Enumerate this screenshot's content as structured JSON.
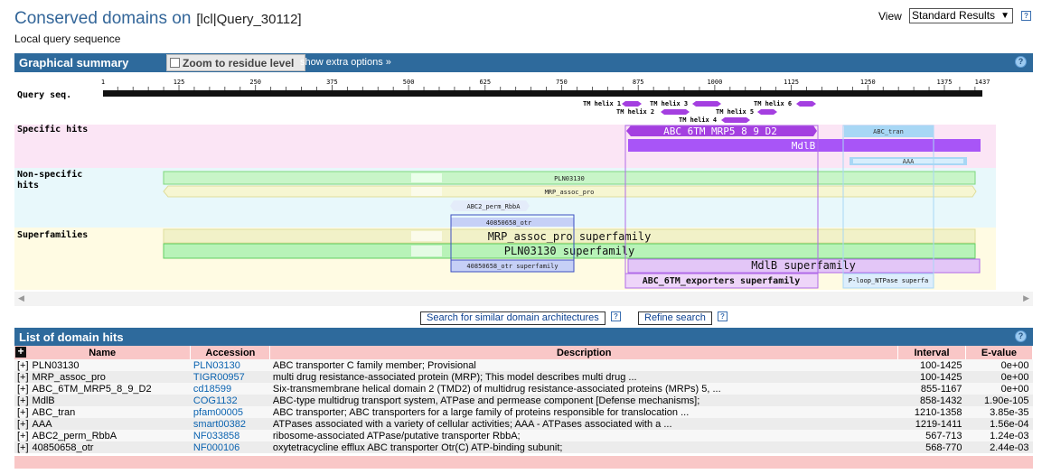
{
  "page": {
    "title": "Conserved domains on",
    "query_id": "[lcl|Query_30112]",
    "subtitle": "Local query sequence",
    "view_label": "View",
    "view_value": "Standard Results",
    "help": "?"
  },
  "graphical": {
    "header": "Graphical summary",
    "zoom_label": "Zoom to residue level",
    "extra_options": "show extra options »",
    "row_labels": {
      "query": "Query seq.",
      "specific": "Specific hits",
      "nonspecific_1": "Non-specific",
      "nonspecific_2": "hits",
      "superfamilies": "Superfamilies"
    },
    "ruler": {
      "length": 1437,
      "ticks": [
        "1",
        "125",
        "250",
        "375",
        "500",
        "625",
        "750",
        "875",
        "1000",
        "1125",
        "1250",
        "1375",
        "1437"
      ]
    },
    "tm_labels": [
      "TM helix 1",
      "TM helix 2",
      "TM helix 3",
      "TM helix 4",
      "TM helix 5",
      "TM helix 6"
    ],
    "hit_labels": {
      "abc6tm": "ABC_6TM_MRP5_8_9_D2",
      "mdlb": "MdlB",
      "abc_tran": "ABC_tran",
      "aaa": "AAA",
      "pln03130": "PLN03130",
      "mrp_assoc": "MRP_assoc_pro",
      "abc2": "ABC2_perm_RbbA",
      "otr": "40850658_otr",
      "sf_mrp": "MRP_assoc_pro superfamily",
      "sf_pln": "PLN03130 superfamily",
      "sf_otr": "40850658_otr superfamily",
      "sf_mdlb": "MdlB superfamily",
      "sf_abc6tm": "ABC_6TM_exporters superfamily",
      "sf_ploop": "P-loop_NTPase superfa"
    }
  },
  "actions": {
    "search_similar": "Search for similar domain architectures",
    "refine": "Refine search"
  },
  "list": {
    "header": "List of domain hits",
    "expand_all": "+",
    "columns": [
      "Name",
      "Accession",
      "Description",
      "Interval",
      "E-value"
    ],
    "rows": [
      {
        "toggle": "[+]",
        "name": "PLN03130",
        "accession": "PLN03130",
        "description": "ABC transporter C family member; Provisional",
        "interval": "100-1425",
        "evalue": "0e+00"
      },
      {
        "toggle": "[+]",
        "name": "MRP_assoc_pro",
        "accession": "TIGR00957",
        "description": "multi drug resistance-associated protein (MRP); This model describes multi drug ...",
        "interval": "100-1425",
        "evalue": "0e+00"
      },
      {
        "toggle": "[+]",
        "name": "ABC_6TM_MRP5_8_9_D2",
        "accession": "cd18599",
        "description": "Six-transmembrane helical domain 2 (TMD2) of multidrug resistance-associated proteins (MRPs) 5, ...",
        "interval": "855-1167",
        "evalue": "0e+00"
      },
      {
        "toggle": "[+]",
        "name": "MdlB",
        "accession": "COG1132",
        "description": "ABC-type multidrug transport system, ATPase and permease component [Defense mechanisms];",
        "interval": "858-1432",
        "evalue": "1.90e-105"
      },
      {
        "toggle": "[+]",
        "name": "ABC_tran",
        "accession": "pfam00005",
        "description": "ABC transporter; ABC transporters for a large family of proteins responsible for translocation ...",
        "interval": "1210-1358",
        "evalue": "3.85e-35"
      },
      {
        "toggle": "[+]",
        "name": "AAA",
        "accession": "smart00382",
        "description": "ATPases associated with a variety of cellular activities; AAA - ATPases associated with a ...",
        "interval": "1219-1411",
        "evalue": "1.56e-04"
      },
      {
        "toggle": "[+]",
        "name": "ABC2_perm_RbbA",
        "accession": "NF033858",
        "description": "ribosome-associated ATPase/putative transporter RbbA;",
        "interval": "567-713",
        "evalue": "1.24e-03"
      },
      {
        "toggle": "[+]",
        "name": "40850658_otr",
        "accession": "NF000106",
        "description": "oxytetracycline efflux ABC transporter Otr(C) ATP-binding subunit;",
        "interval": "568-770",
        "evalue": "2.44e-03"
      }
    ]
  },
  "colors": {
    "header_bar": "#2e6a9c",
    "specific_bg": "#fbe5f5",
    "nonspecific_bg": "#e8f8fb",
    "superfamily_bg": "#fffbe3",
    "table_header": "#f9c7c7",
    "mdlb": "#a855f7",
    "plnd": "#b8f3b8"
  }
}
